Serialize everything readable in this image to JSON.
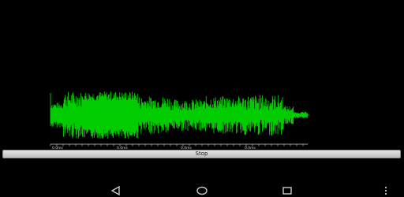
{
  "controls": {
    "stop_label": "Stop"
  },
  "waveform": {
    "color": "#00cc00",
    "axis_color": "#d0d0d0",
    "tick_labels": [
      "0.0ms",
      "0.0ms",
      "0.0ms",
      "0.0ms"
    ]
  },
  "navbar": {
    "icons": [
      "back-icon",
      "home-icon",
      "recents-icon",
      "overflow-icon"
    ],
    "icon_color": "#c8c8c8"
  }
}
